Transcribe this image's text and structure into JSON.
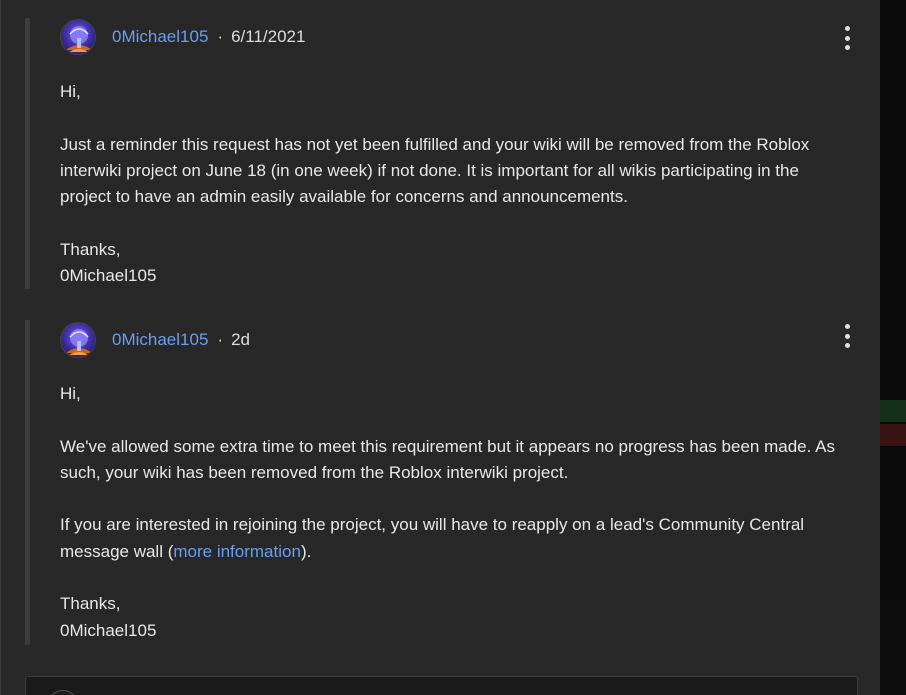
{
  "replies": [
    {
      "author": "0Michael105",
      "separator": "·",
      "timestamp": "6/11/2021",
      "paragraphs": [
        "Hi,",
        "Just a reminder this request has not yet been fulfilled and your wiki will be removed from the Roblox interwiki project on June 18 (in one week) if not done. It is important for all wikis participating in the project to have an admin easily available for concerns and announcements.",
        "Thanks,",
        "0Michael105"
      ]
    },
    {
      "author": "0Michael105",
      "separator": "·",
      "timestamp": "2d",
      "paragraphs": [
        "Hi,",
        "We've allowed some extra time to meet this requirement but it appears no progress has been made. As such, your wiki has been removed from the Roblox interwiki project.",
        "If you are interested in rejoining the project, you will have to reapply on a lead's Community Central message wall (",
        "more information",
        ").",
        "Thanks,",
        "0Michael105"
      ]
    }
  ],
  "colors": {
    "link": "#6b9ef0",
    "panel": "#282828",
    "text": "#e8e8e8"
  },
  "icons": {
    "avatar": "avatar-image",
    "more": "more-options-icon"
  }
}
